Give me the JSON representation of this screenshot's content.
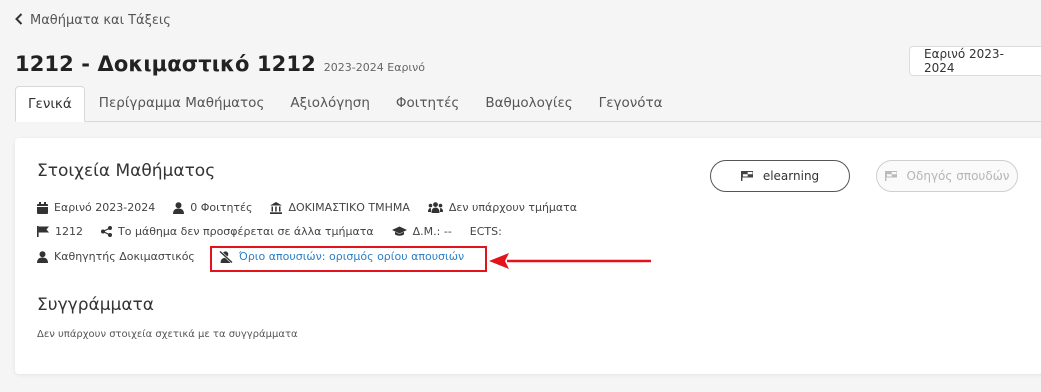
{
  "back_link": {
    "label": "Μαθήματα και Τάξεις"
  },
  "header": {
    "title": "1212 - Δοκιμαστικό 1212",
    "subtitle": "2023-2024 Εαρινό"
  },
  "semester_select": {
    "value": "Εαρινό 2023-2024"
  },
  "tabs": [
    {
      "label": "Γενικά",
      "active": true
    },
    {
      "label": "Περίγραμμα Μαθήματος"
    },
    {
      "label": "Αξιολόγηση"
    },
    {
      "label": "Φοιτητές"
    },
    {
      "label": "Βαθμολογίες"
    },
    {
      "label": "Γεγονότα"
    }
  ],
  "course_info": {
    "title": "Στοιχεία Μαθήματος",
    "semester": "Εαρινό 2023-2024",
    "students": "0 Φοιτητές",
    "department": "ΔΟΚΙΜΑΣΤΙΚΟ ΤΜΗΜΑ",
    "sections": "Δεν υπάρχουν τμήματα",
    "code": "1212",
    "shared": "Το μάθημα δεν προσφέρεται σε άλλα τμήματα",
    "dm": "Δ.Μ.: --",
    "ects": "ECTS:",
    "instructor": "Καθηγητής Δοκιμαστικός",
    "absence_limit": "Όριο απουσιών: ορισμός ορίου απουσιών"
  },
  "buttons": {
    "elearning": "elearning",
    "study_guide": "Οδηγός σπουδών"
  },
  "textbooks": {
    "title": "Συγγράμματα",
    "empty_text": "Δεν υπάρχουν στοιχεία σχετικά με τα συγγράμματα"
  },
  "colors": {
    "accent_link": "#2b7fc4",
    "highlight": "#e3131b"
  }
}
